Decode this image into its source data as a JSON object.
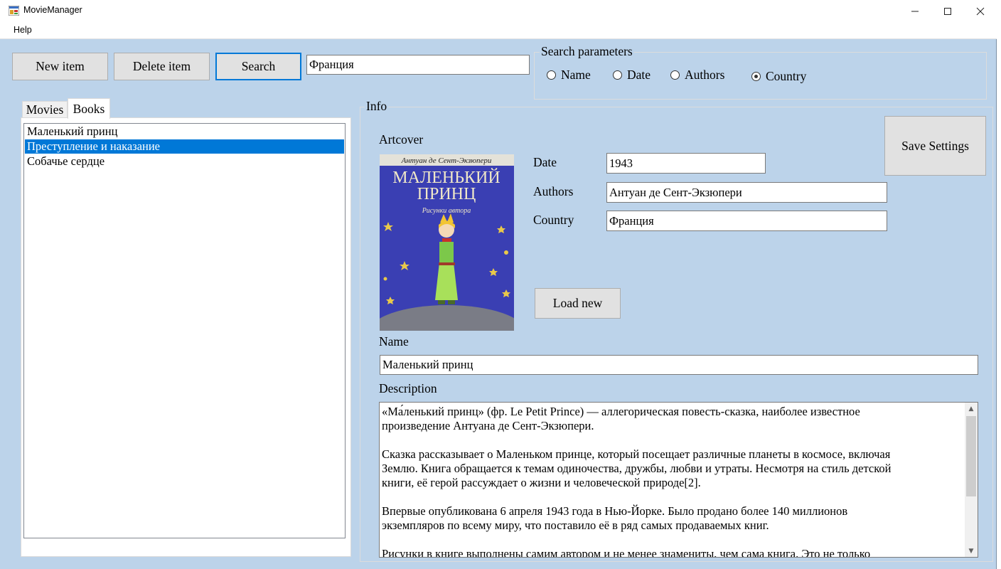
{
  "window": {
    "title": "MovieManager"
  },
  "menu": {
    "help": "Help"
  },
  "toolbar": {
    "new_item": "New item",
    "delete_item": "Delete item",
    "search": "Search",
    "search_value": "Франция"
  },
  "search_params": {
    "title": "Search parameters",
    "options": [
      "Name",
      "Date",
      "Authors",
      "Country"
    ],
    "selected": "Country"
  },
  "tabs": [
    "Movies",
    "Books"
  ],
  "active_tab": "Books",
  "list": {
    "items": [
      "Маленький принц",
      "Преступление и наказание",
      "Собачье сердце"
    ],
    "selected_index": 1
  },
  "info": {
    "title": "Info",
    "artcover_label": "Artcover",
    "save_settings": "Save Settings",
    "date_label": "Date",
    "date_value": "1943",
    "authors_label": "Authors",
    "authors_value": "Антуан де Сент-Экзюпери",
    "country_label": "Country",
    "country_value": "Франция",
    "load_new": "Load new",
    "name_label": "Name",
    "name_value": "Маленький принц",
    "description_label": "Description",
    "description_text": "«Ма́ленький принц» (фр. Le Petit Prince) — аллегорическая повесть-сказка, наиболее известное\nпроизведение Антуана де Сент-Экзюпери.\n\nСказка рассказывает о Маленьком принце, который посещает различные планеты в космосе, включая\nЗемлю. Книга обращается к темам одиночества, дружбы, любви и утраты. Несмотря на стиль детской\nкниги, её герой рассуждает о жизни и человеческой природе[2].\n\nВпервые опубликована 6 апреля 1943 года в Нью-Йорке. Было продано более 140 миллионов\nэкземпляров по всему миру, что поставило её в ряд самых продаваемых книг.\n\nРисунки в книге выполнены самим автором и не менее знамениты, чем сама книга. Это не только"
  },
  "cover": {
    "author": "Антуан де Сент-Экзюпери",
    "title_line1": "МАЛЕНЬКИЙ",
    "title_line2": "ПРИНЦ",
    "subtitle": "Рисунки автора"
  }
}
